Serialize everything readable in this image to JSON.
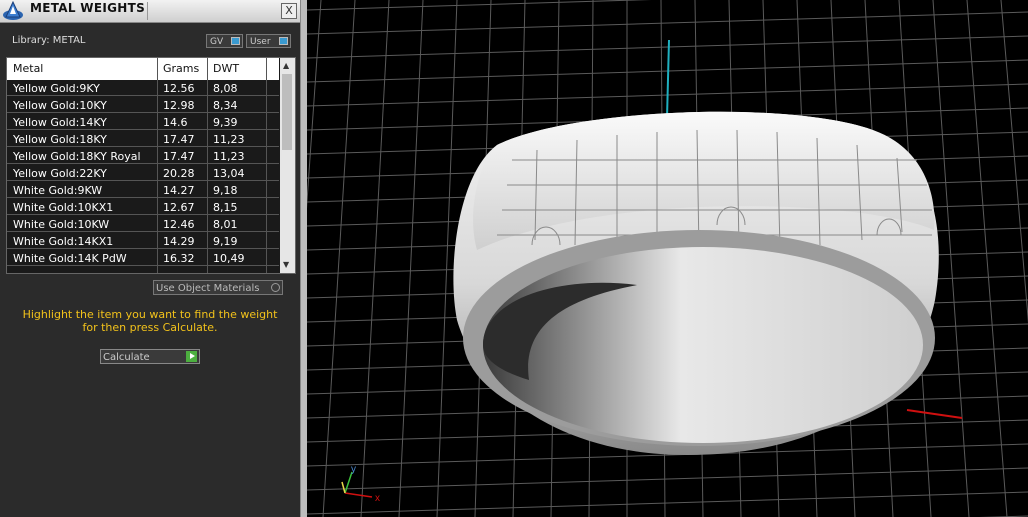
{
  "window": {
    "title": "METAL WEIGHTS",
    "close_label": "X"
  },
  "library": {
    "label": "Library: METAL",
    "toggles": [
      "GV",
      "User"
    ]
  },
  "table": {
    "columns": [
      "Metal",
      "Grams",
      "DWT"
    ],
    "rows": [
      [
        "Yellow Gold:9KY",
        "12.56",
        "8,08"
      ],
      [
        "Yellow Gold:10KY",
        "12.98",
        "8,34"
      ],
      [
        "Yellow Gold:14KY",
        "14.6",
        "9,39"
      ],
      [
        "Yellow Gold:18KY",
        "17.47",
        "11,23"
      ],
      [
        "Yellow Gold:18KY Royal",
        "17.47",
        "11,23"
      ],
      [
        "Yellow Gold:22KY",
        "20.28",
        "13,04"
      ],
      [
        "White Gold:9KW",
        "14.27",
        "9,18"
      ],
      [
        "White Gold:10KX1",
        "12.67",
        "8,15"
      ],
      [
        "White Gold:10KW",
        "12.46",
        "8,01"
      ],
      [
        "White Gold:14KX1",
        "14.29",
        "9,19"
      ],
      [
        "White Gold:14K PdW",
        "16.32",
        "10,49"
      ]
    ]
  },
  "use_object_materials": {
    "label": "Use Object Materials"
  },
  "hint": {
    "line1": "Highlight the item you want to find the weight",
    "line2": "for then press Calculate."
  },
  "calculate": {
    "label": "Calculate"
  },
  "viewport": {
    "axis_x": "x",
    "axis_y": "y"
  },
  "colors": {
    "hint": "#f2c21b",
    "grid": "#5a5a5a",
    "axis_x": "#d01010",
    "axis_y": "#1fb0c0"
  }
}
